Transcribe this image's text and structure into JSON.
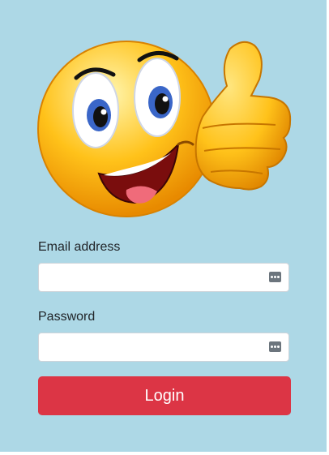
{
  "mascot": {
    "icon": "thumbs-up-smiley-icon"
  },
  "form": {
    "email": {
      "label": "Email address",
      "value": "",
      "placeholder": "",
      "autofill_icon": "password-manager-icon"
    },
    "password": {
      "label": "Password",
      "value": "",
      "placeholder": "",
      "autofill_icon": "password-manager-icon"
    },
    "submit_label": "Login"
  },
  "colors": {
    "background": "#add8e6",
    "button": "#dc3545",
    "button_text": "#ffffff",
    "smiley": "#ffc21a"
  }
}
